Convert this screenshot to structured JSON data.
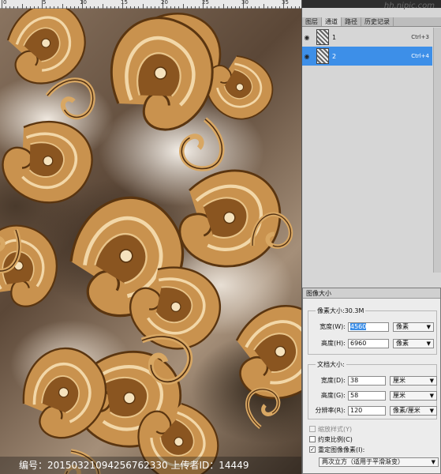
{
  "ruler": {
    "numbers": [
      "0",
      "5",
      "10",
      "15",
      "20",
      "25",
      "30",
      "35"
    ]
  },
  "site_mark": "hh.nipic.com",
  "watermark": {
    "line": "编号：20150321094256762330 上传者ID：14449"
  },
  "panel": {
    "tabs": [
      "图层",
      "通道",
      "路径",
      "历史记录"
    ],
    "active_tab": "通道",
    "layers": [
      {
        "name": "1",
        "shortcut": "Ctrl+3",
        "selected": false
      },
      {
        "name": "2",
        "shortcut": "Ctrl+4",
        "selected": true
      }
    ]
  },
  "dialog": {
    "title": "图像大小",
    "pixel_dims": {
      "label": "像素大小:30.3M",
      "width_label": "宽度(W):",
      "width_value": "4560",
      "width_unit": "像素",
      "height_label": "高度(H):",
      "height_value": "6960",
      "height_unit": "像素"
    },
    "doc_size": {
      "label": "文档大小:",
      "width_label": "宽度(D):",
      "width_value": "38",
      "width_unit": "厘米",
      "height_label": "高度(G):",
      "height_value": "58",
      "height_unit": "厘米",
      "res_label": "分辨率(R):",
      "res_value": "120",
      "res_unit": "像素/厘米"
    },
    "options": {
      "scale_styles": "缩放样式(Y)",
      "constrain": "约束比例(C)",
      "resample": "重定图像像素(I):",
      "resample_method": "两次立方（适用于平滑渐变）"
    }
  }
}
